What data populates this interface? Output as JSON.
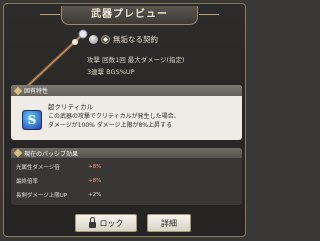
{
  "dialog": {
    "title": "武器プレビュー"
  },
  "weapon": {
    "name": "無垢なる契約",
    "stat_line1": "攻撃 回数1回 最大ダメージ(指定)",
    "stat_line2": "3連撃 BGS%UP"
  },
  "ability": {
    "header": "固有特性",
    "icon_letter": "S",
    "name": "超クリティカル",
    "description": "この武器の攻撃でクリティカルが発生した場合、\nダメージが100% ダメージ上限が8%上昇する"
  },
  "passive": {
    "header": "現在のパッシブ効果",
    "rows": [
      {
        "label": "光属性ダメージ倍",
        "value": "+8%"
      },
      {
        "label": "最終倍率",
        "value": "+8%"
      },
      {
        "label": "長剣ダメージ上限UP",
        "value": "+2%"
      }
    ]
  },
  "buttons": {
    "lock": "ロック",
    "detail": "詳細"
  },
  "colors": {
    "accent_gold": "#a89870",
    "passive_value": "#e8a08c",
    "ability_icon": "#2a3fb0"
  }
}
